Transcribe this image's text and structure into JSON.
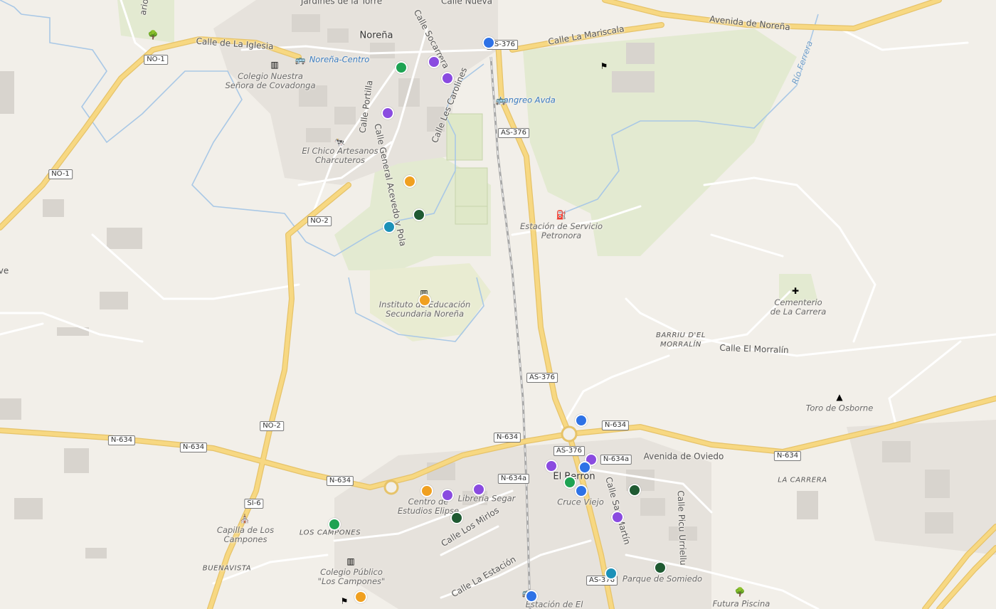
{
  "colors": {
    "background": "#f2efe9",
    "road_major": "#f7d882",
    "road_casing": "#e6c36a",
    "road_minor": "#ffffff",
    "water": "#a9c8e6",
    "park": "#e3ead1",
    "building": "#dcd8d2",
    "marker_purple": "#8a4be0",
    "marker_green": "#1ea353",
    "marker_darkgreen": "#1f5a32",
    "marker_orange": "#f0a020",
    "marker_blue": "#2e72e6",
    "marker_teal": "#1c91b8"
  },
  "towns": [
    "Noreña",
    "El Berrón"
  ],
  "neighborhoods": [
    "BARRIU D'EL\nMORRALÍN",
    "LA CARRERA",
    "LOS CAMPONES",
    "BUENAVISTA"
  ],
  "streets": [
    "Jardines de la Torre",
    "Calle Nueva",
    "Calle de La Iglesia",
    "Calle Socarrera",
    "Calle La Mariscala",
    "Avenida de Noreña",
    "Calle Les Carolines",
    "Calle Portilla",
    "Calle General Acevedo y Pola",
    "Calle El Morralín",
    "Avenida de Oviedo",
    "Calle San Martín",
    "Calle Picu Urriellu",
    "Calle Los Mirlos",
    "Calle La Estación"
  ],
  "water_labels": [
    "Río Ferrera"
  ],
  "transit_labels": [
    "Noreña-Centro",
    "Langreo Avda"
  ],
  "pois": [
    "Colegio Nuestra\nSeñora de Covadonga",
    "El Chico Artesanos\nCharcuteros",
    "Estación de Servicio\nPetronora",
    "Instituto de Educación\nSecundaria Noreña",
    "Cementerio\nde La Carrera",
    "Toro de Osborne",
    "Centro de\nEstudios Elipse",
    "Librería Segar",
    "Cruce Viejo",
    "Capilla de Los\nCampones",
    "Colegio Público\n\"Los Campones\"",
    "Parque de Somiedo",
    "Futura Piscina",
    "Estación de El"
  ],
  "route_shields": [
    "AS-376",
    "AS-376",
    "AS-376",
    "AS-376",
    "AS-376",
    "NO-1",
    "NO-1",
    "NO-2",
    "NO-2",
    "N-634",
    "N-634",
    "N-634",
    "N-634",
    "N-634",
    "N-634",
    "N-634a",
    "N-634a",
    "SI-6"
  ],
  "left_edge_text": "ve",
  "top_left_text": "ario",
  "markers": [
    {
      "color": "purple"
    },
    {
      "color": "purple"
    },
    {
      "color": "green"
    },
    {
      "color": "blue"
    },
    {
      "color": "purple"
    },
    {
      "color": "orange"
    },
    {
      "color": "darkgreen"
    },
    {
      "color": "teal"
    },
    {
      "color": "orange"
    },
    {
      "color": "blue"
    },
    {
      "color": "purple"
    },
    {
      "color": "blue"
    },
    {
      "color": "purple"
    },
    {
      "color": "green"
    },
    {
      "color": "blue"
    },
    {
      "color": "darkgreen"
    },
    {
      "color": "purple"
    },
    {
      "color": "purple"
    },
    {
      "color": "orange"
    },
    {
      "color": "purple"
    },
    {
      "color": "darkgreen"
    },
    {
      "color": "green"
    },
    {
      "color": "teal"
    },
    {
      "color": "darkgreen"
    },
    {
      "color": "blue"
    },
    {
      "color": "orange"
    }
  ],
  "icons": [
    "tree-icon",
    "school-icon",
    "bus-stop-icon",
    "bus-stop-icon",
    "butcher-icon",
    "fuel-station-icon",
    "school-icon",
    "cemetery-icon",
    "monument-icon",
    "chapel-icon",
    "school-icon",
    "tree-icon",
    "playground-icon",
    "playground-icon",
    "bus-stop-icon"
  ]
}
